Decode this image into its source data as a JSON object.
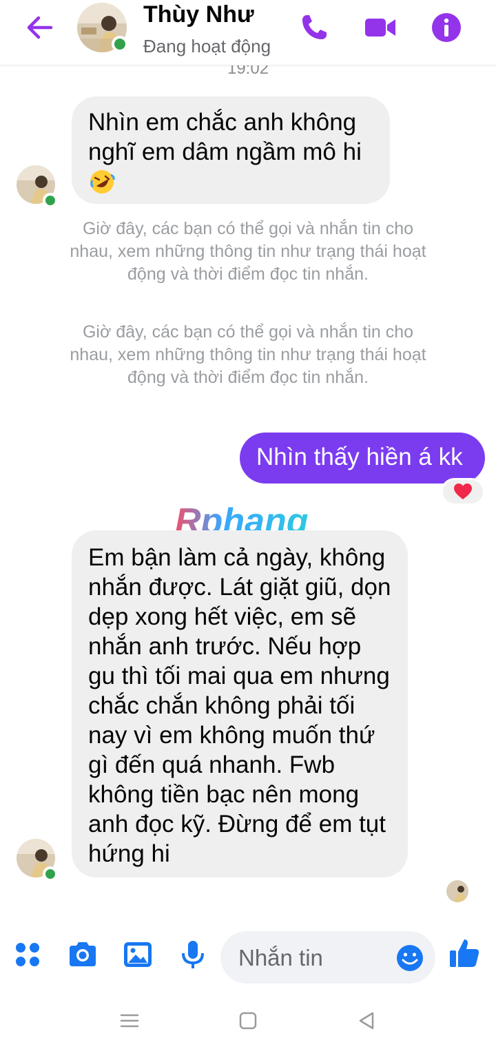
{
  "header": {
    "contact_name": "Thùy Như",
    "status": "Đang hoạt động",
    "icons": [
      "back-arrow-icon",
      "phone-icon",
      "video-camera-icon",
      "info-icon"
    ],
    "accent_color": "#9333ea",
    "online_color": "#31a24c"
  },
  "conversation": {
    "timestamp": "19:02",
    "messages": [
      {
        "from": "contact",
        "text": "Nhìn em chắc anh không nghĩ em dâm ngầm mô hi",
        "emoji": "rolling-on-floor-laughing-emoji"
      },
      {
        "from": "system",
        "text": "Giờ đây, các bạn có thể gọi và nhắn tin cho nhau, xem những thông tin như trạng thái hoạt động và thời điểm đọc tin nhắn."
      },
      {
        "from": "system",
        "text": "Giờ đây, các bạn có thể gọi và nhắn tin cho nhau, xem những thông tin như trạng thái hoạt động và thời điểm đọc tin nhắn."
      },
      {
        "from": "me",
        "text": "Nhìn thấy hiền á kk",
        "reaction": "heart-icon"
      },
      {
        "from": "contact",
        "text": "Em bận làm cả ngày, không nhắn được. Lát giặt giũ, dọn dẹp xong hết việc, em sẽ nhắn anh trước. Nếu hợp gu thì tối mai qua em nhưng chắc chắn không phải tối nay vì em không muốn thứ gì đến quá nhanh. Fwb không tiền bạc nên mong anh đọc kỹ. Đừng để em tụt hứng hi"
      }
    ],
    "watermark": "Rphang",
    "outgoing_bubble_color": "#7b3cf0",
    "incoming_bubble_color": "#efefef"
  },
  "composer": {
    "placeholder": "Nhắn tin",
    "icons": [
      "apps-grid-icon",
      "camera-icon",
      "image-icon",
      "microphone-icon",
      "emoji-icon",
      "thumbs-up-icon"
    ]
  },
  "navbar": {
    "icons": [
      "recent-apps-icon",
      "home-icon",
      "back-icon"
    ]
  }
}
